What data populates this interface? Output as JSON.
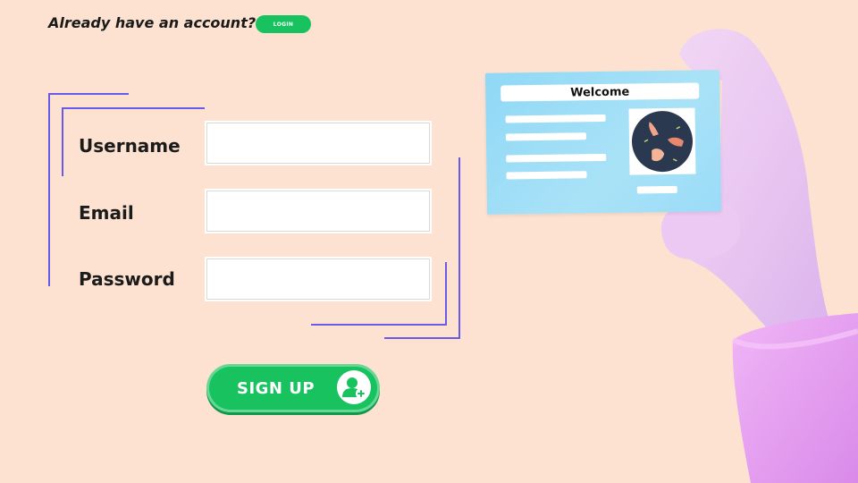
{
  "header": {
    "prompt_text": "Already have an account?",
    "login_label": "LOGIN"
  },
  "form": {
    "fields": [
      {
        "label": "Username",
        "value": "",
        "placeholder": ""
      },
      {
        "label": "Email",
        "value": "",
        "placeholder": ""
      },
      {
        "label": "Password",
        "value": "",
        "placeholder": ""
      }
    ],
    "submit_label": "SIGN UP",
    "submit_icon": "add-user-icon"
  },
  "card": {
    "title": "Welcome",
    "photo_icon": "handshake-hands-icon"
  },
  "colors": {
    "background": "#fde2d2",
    "accent_green": "#17c25f",
    "accent_line": "#6a5ae8",
    "card_blue": "#9bdcf8",
    "hand_pink": "#e9c8f2",
    "sleeve_purple": "#e59af2"
  }
}
